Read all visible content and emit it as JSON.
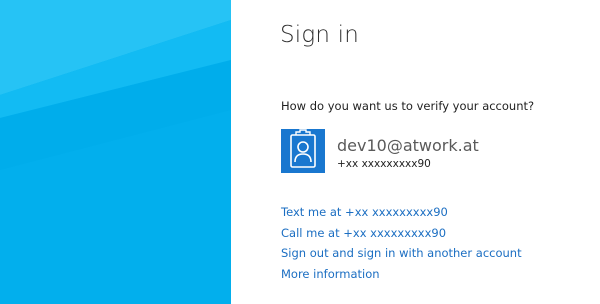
{
  "page": {
    "title": "Sign in",
    "prompt": "How do you want us to verify your account?"
  },
  "account": {
    "avatar_icon": "user-badge-icon",
    "email": "dev10@atwork.at",
    "phone": "+xx xxxxxxxxx90"
  },
  "options": {
    "text_me": "Text me at +xx xxxxxxxxx90",
    "call_me": "Call me at +xx xxxxxxxxx90",
    "sign_out": "Sign out and sign in with another account",
    "more_info": "More information"
  },
  "colors": {
    "art_primary": "#00b3f0",
    "art_light": "#22c1f4",
    "avatar_bg": "#1977cf",
    "link": "#1b6ec2"
  }
}
